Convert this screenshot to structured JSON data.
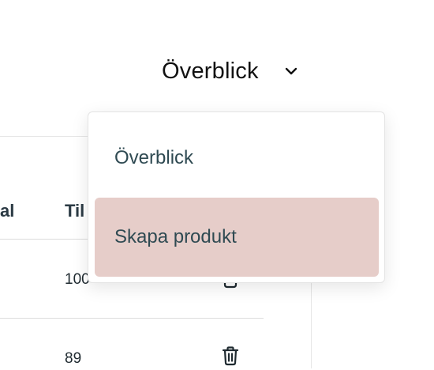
{
  "header": {
    "view_selector": {
      "selected": "Överblick",
      "icon": "chevron-down-icon"
    }
  },
  "dropdown": {
    "items": [
      {
        "label": "Överblick",
        "highlighted": false
      },
      {
        "label": "Skapa produkt",
        "highlighted": true
      }
    ],
    "highlight_color": "#e6cdc9"
  },
  "table": {
    "columns": [
      "al",
      "Til"
    ],
    "rows": [
      {
        "value": "100"
      },
      {
        "value": "89"
      }
    ],
    "row_icon": "trash-icon"
  }
}
